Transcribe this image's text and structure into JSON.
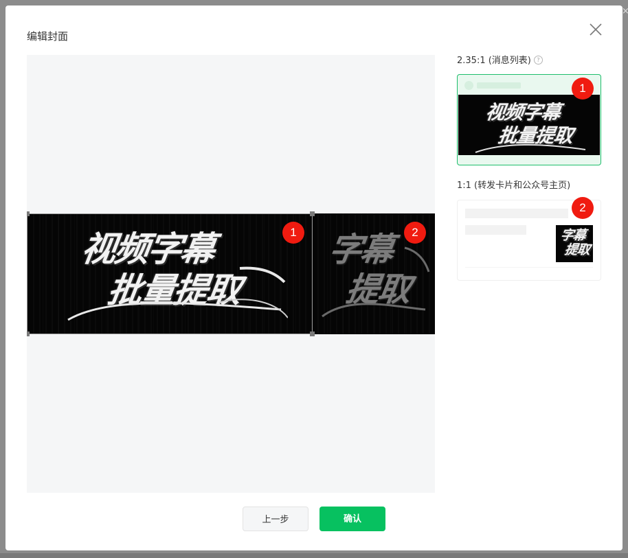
{
  "modal": {
    "title": "编辑封面"
  },
  "cover": {
    "line1": "视频字幕",
    "line2": "批量提取",
    "second_line1": "字幕",
    "second_line2": "提取"
  },
  "badges": {
    "one": "1",
    "two": "2"
  },
  "preview_list": {
    "label": "2.35:1 (消息列表)",
    "help": "?"
  },
  "preview_card": {
    "label": "1:1 (转发卡片和公众号主页)",
    "thumb_line1": "字幕",
    "thumb_line2": "提取"
  },
  "buttons": {
    "prev": "上一步",
    "confirm": "确认"
  },
  "colors": {
    "accent": "#07c160",
    "selected_border": "#1cbd6a",
    "badge": "#f01b10"
  }
}
